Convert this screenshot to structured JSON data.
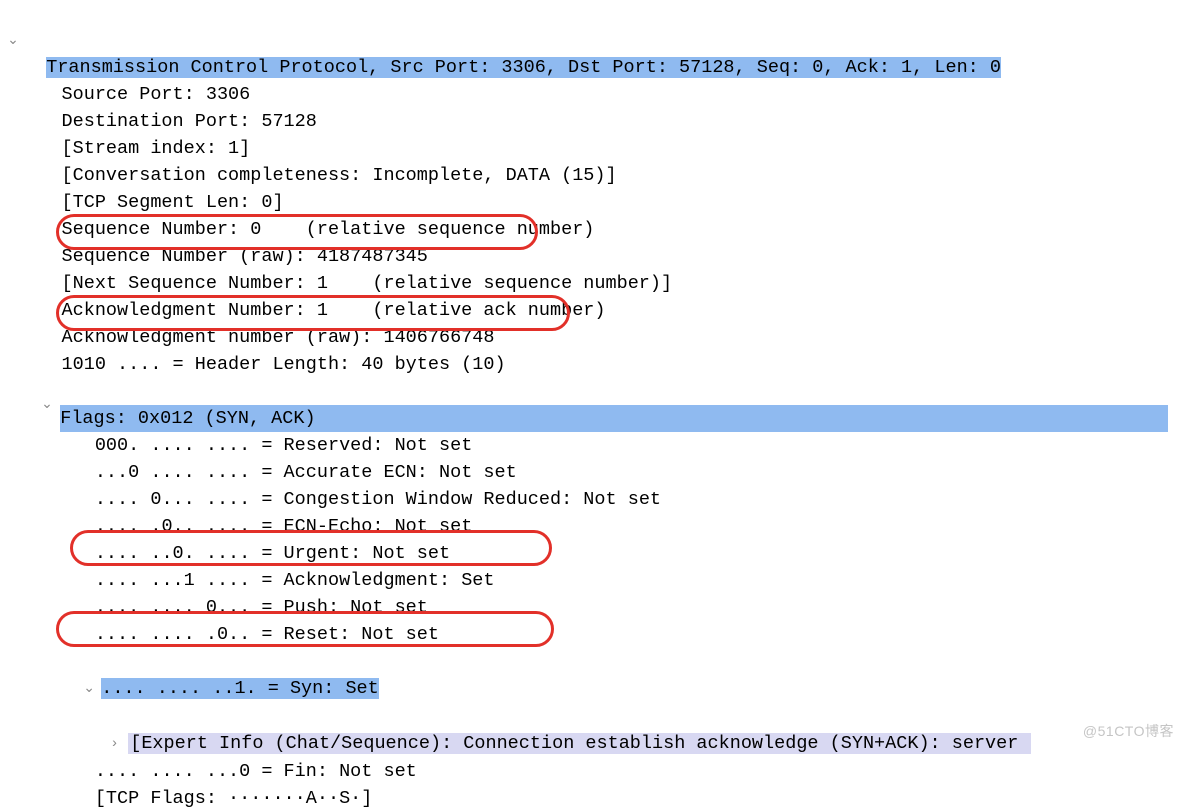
{
  "tcp_header": "Transmission Control Protocol, Src Port: 3306, Dst Port: 57128, Seq: 0, Ack: 1, Len: 0",
  "src_port": "Source Port: 3306",
  "dst_port": "Destination Port: 57128",
  "stream_index": "[Stream index: 1]",
  "conv_complete": "[Conversation completeness: Incomplete, DATA (15)]",
  "seg_len": "[TCP Segment Len: 0]",
  "seq_rel": "Sequence Number: 0    (relative sequence number)",
  "seq_raw": "Sequence Number (raw): 4187487345",
  "seq_next": "[Next Sequence Number: 1    (relative sequence number)]",
  "ack_rel": "Acknowledgment Number: 1    (relative ack number)",
  "ack_raw": "Acknowledgment number (raw): 1406766748",
  "hdr_len": "1010 .... = Header Length: 40 bytes (10)",
  "flags_summary": "Flags: 0x012 (SYN, ACK)",
  "flag_reserved": "000. .... .... = Reserved: Not set",
  "flag_aecn": "...0 .... .... = Accurate ECN: Not set",
  "flag_cwr": ".... 0... .... = Congestion Window Reduced: Not set",
  "flag_ece": ".... .0.. .... = ECN-Echo: Not set",
  "flag_urg": ".... ..0. .... = Urgent: Not set",
  "flag_ack": ".... ...1 .... = Acknowledgment: Set",
  "flag_psh": ".... .... 0... = Push: Not set",
  "flag_rst": ".... .... .0.. = Reset: Not set",
  "flag_syn": ".... .... ..1. = Syn: Set",
  "expert_info": "[Expert Info (Chat/Sequence): Connection establish acknowledge (SYN+ACK): server ",
  "flag_fin": ".... .... ...0 = Fin: Not set",
  "tcp_flags_str": "[TCP Flags: ·······A··S·]",
  "watermark": "@51CTO博客"
}
